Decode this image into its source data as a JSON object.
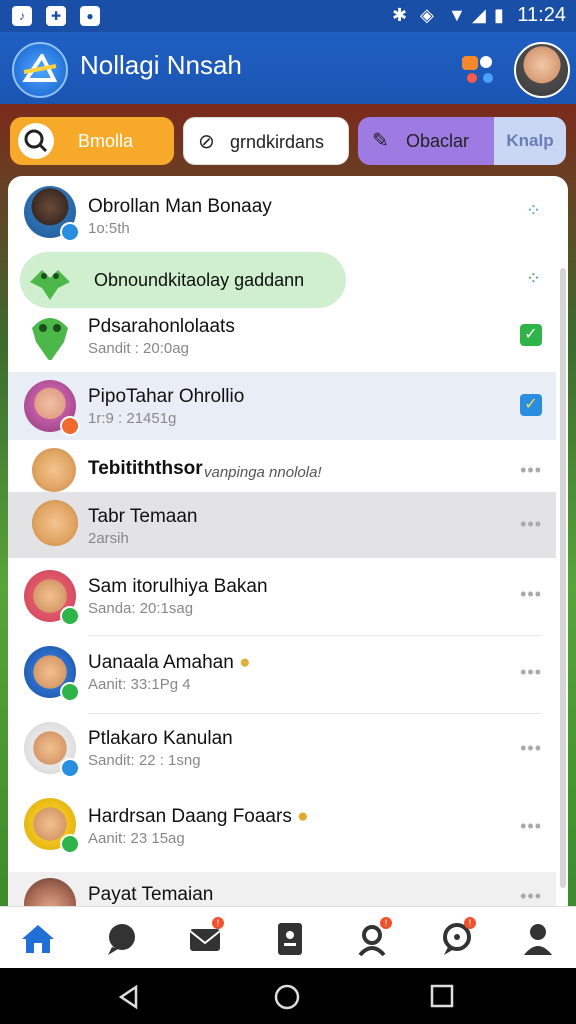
{
  "status_bar": {
    "time": "11:24",
    "app_icons": [
      "notification-icon",
      "notification-icon",
      "notification-icon"
    ]
  },
  "header": {
    "title": "Nollagi Nnsah"
  },
  "filters": {
    "chip1": "Bmolla",
    "chip2": "grndkirdans",
    "chip3": "Obaclar",
    "chip3_segment": "Knalp"
  },
  "rows": [
    {
      "name": "Obrollan Man Bonaay",
      "sub": "1o:5th"
    },
    {
      "name": "Obnoundkitaolay gaddann",
      "sub": ""
    },
    {
      "name": "Pdsarahonlolaats",
      "sub": "Sandit : 20:0ag"
    },
    {
      "name": "PipoTahar Ohrollio",
      "sub": "1r:9 : 21451g"
    },
    {
      "name": "Tebitiththsor",
      "sub": "vanpinga nnolola!"
    },
    {
      "name": "Tabr Temaan",
      "sub": "2arsih"
    },
    {
      "name": "Sam itorulhiya Bakan",
      "sub": "Sanda: 20:1sag"
    },
    {
      "name": "Uanaala Amahan",
      "sub": "Aanit: 33:1Pg  4"
    },
    {
      "name": "Ptlakaro Kanulan",
      "sub": "Sandit: 22 : 1sng"
    },
    {
      "name": "Hardrsan Daang Foaars",
      "sub": "Aanit: 23 15ag"
    },
    {
      "name": "Payat Temaian",
      "sub": ""
    }
  ],
  "colors": {
    "primary": "#1f5fc2",
    "accent_orange": "#f7a92a",
    "accent_purple": "#9d7be3",
    "check_green": "#2fb44a",
    "check_blue": "#2a8ee0",
    "nav_active": "#1f6fd6",
    "badge_red": "#f0522d"
  },
  "bottom_nav": [
    "home-icon",
    "chat-icon",
    "mail-icon",
    "contacts-icon",
    "friends-icon",
    "messages-icon",
    "profile-icon"
  ]
}
